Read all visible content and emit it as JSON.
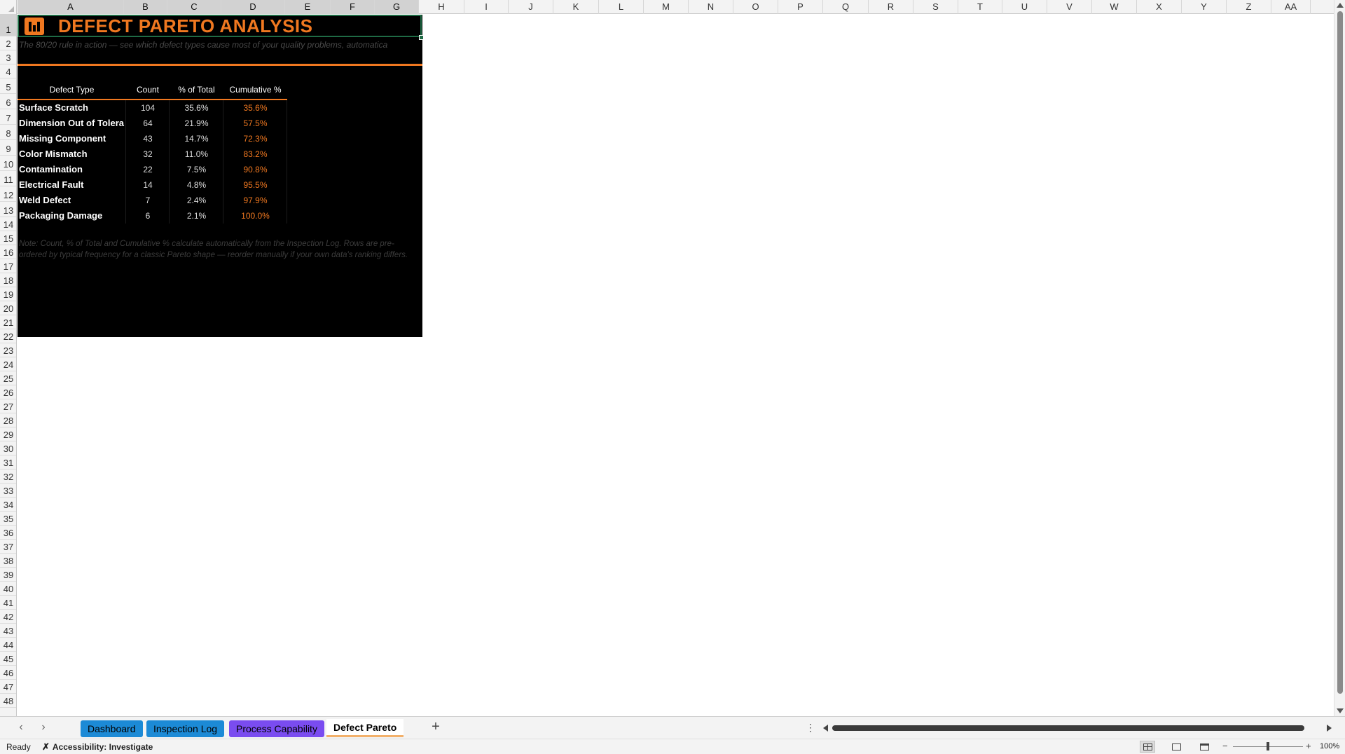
{
  "sheet": {
    "columns": [
      "A",
      "B",
      "C",
      "D",
      "E",
      "F",
      "G",
      "H",
      "I",
      "J",
      "K",
      "L",
      "M",
      "N",
      "O",
      "P",
      "Q",
      "R",
      "S",
      "T",
      "U",
      "V",
      "W",
      "X",
      "Y",
      "Z",
      "AA"
    ],
    "rows": [
      "1",
      "2",
      "3",
      "4",
      "5",
      "6",
      "7",
      "8",
      "9",
      "10",
      "11",
      "12",
      "13",
      "14",
      "15",
      "16",
      "17",
      "18",
      "19",
      "20",
      "21",
      "22",
      "23",
      "24",
      "25",
      "26",
      "27",
      "28",
      "29",
      "30",
      "31",
      "32",
      "33",
      "34",
      "35",
      "36",
      "37",
      "38",
      "39",
      "40",
      "41",
      "42",
      "43",
      "44",
      "45",
      "46",
      "47",
      "48"
    ]
  },
  "dashboard": {
    "title": "DEFECT PARETO ANALYSIS",
    "subtitle": "The 80/20 rule in action — see which defect types cause most of your quality problems, automatica",
    "headers": {
      "type": "Defect Type",
      "count": "Count",
      "pct": "% of Total",
      "cum": "Cumulative %"
    },
    "rows": [
      {
        "type": "Surface Scratch",
        "count": "104",
        "pct": "35.6%",
        "cum": "35.6%"
      },
      {
        "type": "Dimension Out of Tolera",
        "count": "64",
        "pct": "21.9%",
        "cum": "57.5%"
      },
      {
        "type": "Missing Component",
        "count": "43",
        "pct": "14.7%",
        "cum": "72.3%"
      },
      {
        "type": "Color Mismatch",
        "count": "32",
        "pct": "11.0%",
        "cum": "83.2%"
      },
      {
        "type": "Contamination",
        "count": "22",
        "pct": "7.5%",
        "cum": "90.8%"
      },
      {
        "type": "Electrical Fault",
        "count": "14",
        "pct": "4.8%",
        "cum": "95.5%"
      },
      {
        "type": "Weld Defect",
        "count": "7",
        "pct": "2.4%",
        "cum": "97.9%"
      },
      {
        "type": "Packaging Damage",
        "count": "6",
        "pct": "2.1%",
        "cum": "100.0%"
      }
    ],
    "note": "Note: Count, % of Total and Cumulative % calculate automatically from the Inspection Log. Rows are pre-ordered by typical frequency for a classic Pareto shape — reorder manually if your own data's ranking differs.",
    "colors": {
      "accent": "#f07820",
      "panel_bg": "#000000"
    }
  },
  "tabs": {
    "items": [
      {
        "label": "Dashboard",
        "color": "#1c8ad6"
      },
      {
        "label": "Inspection Log",
        "color": "#1c8ad6"
      },
      {
        "label": "Process Capability",
        "color": "#7a4cf0"
      },
      {
        "label": "Defect Pareto",
        "active": true
      }
    ],
    "add_label": "+",
    "more_label": "⋮"
  },
  "status": {
    "ready": "Ready",
    "accessibility": "Accessibility: Investigate",
    "zoom": "100%"
  },
  "icons": {
    "logo": "bar-chart-icon",
    "accessibility": "accessibility-icon",
    "prev_sheet": "chevron-left-icon",
    "next_sheet": "chevron-right-icon"
  }
}
